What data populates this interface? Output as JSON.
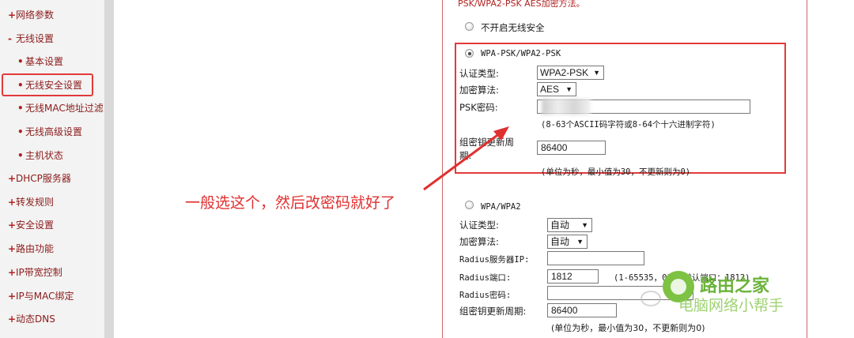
{
  "sidebar": {
    "items": [
      {
        "marker": "+",
        "label": "网络参数"
      },
      {
        "marker": "-",
        "label": "无线设置"
      },
      {
        "marker": "•",
        "label": "基本设置"
      },
      {
        "marker": "•",
        "label": "无线安全设置"
      },
      {
        "marker": "•",
        "label": "无线MAC地址过滤"
      },
      {
        "marker": "•",
        "label": "无线高级设置"
      },
      {
        "marker": "•",
        "label": "主机状态"
      },
      {
        "marker": "+",
        "label": "DHCP服务器"
      },
      {
        "marker": "+",
        "label": "转发规则"
      },
      {
        "marker": "+",
        "label": "安全设置"
      },
      {
        "marker": "+",
        "label": "路由功能"
      },
      {
        "marker": "+",
        "label": "IP带宽控制"
      },
      {
        "marker": "+",
        "label": "IP与MAC绑定"
      },
      {
        "marker": "+",
        "label": "动态DNS"
      }
    ]
  },
  "main": {
    "top_note": "PSK/WPA2-PSK AES加密方法。",
    "option_none": "不开启无线安全",
    "wpa_psk": {
      "title": "WPA-PSK/WPA2-PSK",
      "auth_label": "认证类型:",
      "auth_value": "WPA2-PSK",
      "enc_label": "加密算法:",
      "enc_value": "AES",
      "psk_label": "PSK密码:",
      "psk_hint": "(8-63个ASCII码字符或8-64个十六进制字符)",
      "renew_label_1": "组密钥更新周",
      "renew_label_2": "期:",
      "renew_value": "86400",
      "renew_hint": "(单位为秒，最小值为30，不更新则为0)"
    },
    "wpa": {
      "title": "WPA/WPA2",
      "auth_label": "认证类型:",
      "auth_value": "自动",
      "enc_label": "加密算法:",
      "enc_value": "自动",
      "radius_ip_label": "Radius服务器IP:",
      "radius_port_label": "Radius端口:",
      "radius_port_value": "1812",
      "radius_port_hint": "(1-65535，0表示默认端口：1812)",
      "radius_pwd_label": "Radius密码:",
      "renew_label": "组密钥更新周期:",
      "renew_value": "86400",
      "renew_hint": "(单位为秒，最小值为30，不更新则为0)"
    }
  },
  "annotation": "一般选这个，然后改密码就好了",
  "watermark": {
    "line1": "路由之家",
    "line2": "电脑网络小帮手"
  },
  "colors": {
    "accent_red": "#e23a3a",
    "sidebar_text": "#8b1a1a",
    "watermark_green": "#6bb33a"
  }
}
